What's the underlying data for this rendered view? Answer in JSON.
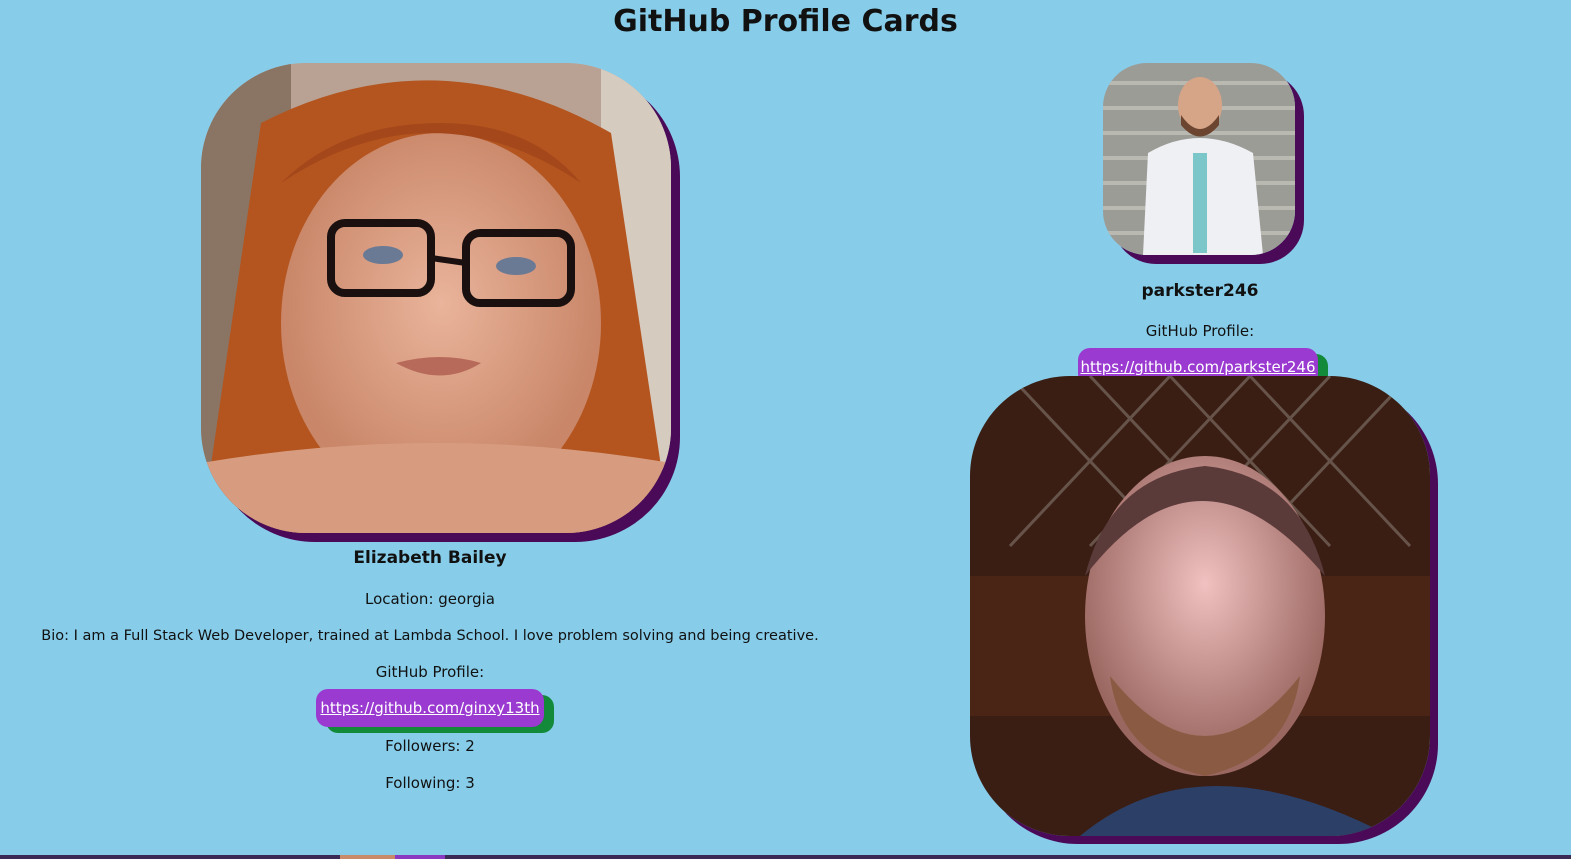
{
  "page": {
    "title": "GitHub Profile Cards"
  },
  "cards": [
    {
      "name": "Elizabeth Bailey",
      "location": "Location: georgia",
      "bio": "Bio: I am a Full Stack Web Developer, trained at Lambda School. I love problem solving and being creative.",
      "profile_label": "GitHub Profile:",
      "profile_url": "https://github.com/ginxy13th",
      "followers": "Followers: 2",
      "following": "Following: 3"
    },
    {
      "name": "parkster246",
      "profile_label": "GitHub Profile:",
      "profile_url": "https://github.com/parkster246"
    }
  ],
  "colors": {
    "background": "#87CDEA",
    "avatar_shadow": "#4A0A57",
    "link_pill": "#9B3AD0",
    "link_pill_shadow": "#138A3A"
  }
}
